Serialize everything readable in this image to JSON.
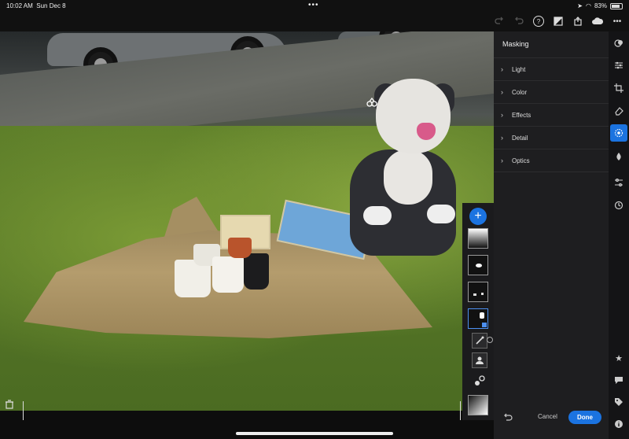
{
  "status": {
    "time": "10:02 AM",
    "date": "Sun Dec 8",
    "battery": "83%",
    "dots": "•••"
  },
  "topbar": {
    "icons": [
      "redo-icon",
      "undo-icon",
      "help-icon",
      "compare-icon",
      "share-icon",
      "cloud-icon",
      "more-icon"
    ],
    "help_glyph": "?",
    "more_glyph": "•••"
  },
  "masking": {
    "title": "Masking",
    "sections": [
      {
        "label": "Light"
      },
      {
        "label": "Color"
      },
      {
        "label": "Effects"
      },
      {
        "label": "Detail"
      },
      {
        "label": "Optics"
      }
    ]
  },
  "mask_panel": {
    "add_glyph": "+"
  },
  "footer": {
    "cancel_label": "Cancel",
    "done_label": "Done"
  },
  "colors": {
    "accent": "#1b73e0",
    "panel": "#1e1e20"
  }
}
